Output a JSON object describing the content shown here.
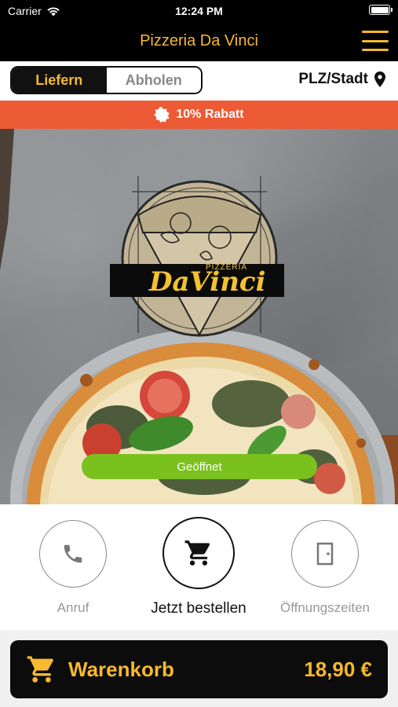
{
  "status_bar": {
    "carrier": "Carrier",
    "time": "12:24 PM"
  },
  "nav": {
    "title": "Pizzeria Da Vinci",
    "menu_icon": "hamburger-menu-icon"
  },
  "mode": {
    "deliver_label": "Liefern",
    "pickup_label": "Abholen",
    "active": "deliver",
    "location_label": "PLZ/Stadt"
  },
  "discount": {
    "label": "10% Rabatt",
    "icon": "badge-icon"
  },
  "hero": {
    "logo_small_text": "PIZZERIA",
    "logo_text": "DaVinci",
    "status_label": "Geöffnet"
  },
  "actions": {
    "call_label": "Anruf",
    "order_label": "Jetzt bestellen",
    "hours_label": "Öffnungszeiten"
  },
  "cart": {
    "label": "Warenkorb",
    "total": "18,90 €"
  },
  "colors": {
    "accent": "#f6b92f",
    "discount": "#ec5a36",
    "open": "#7ac11e",
    "dark": "#0c0c0c"
  }
}
